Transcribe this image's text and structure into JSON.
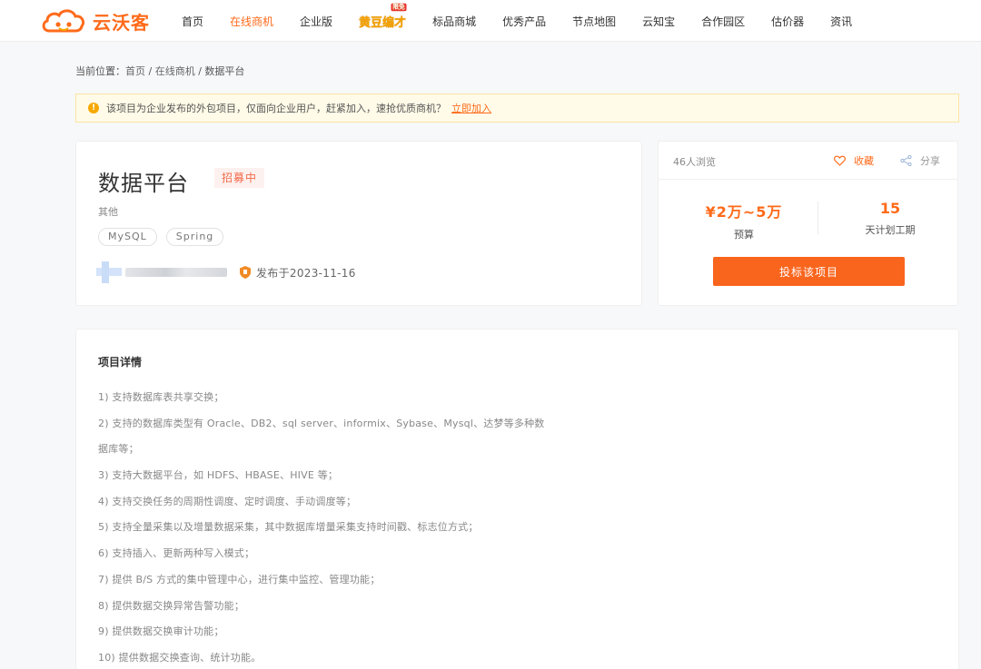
{
  "header": {
    "logo_text": "云沃客",
    "nav": [
      {
        "label": "首页"
      },
      {
        "label": "在线商机"
      },
      {
        "label": "企业版"
      },
      {
        "label": "黄豆编才",
        "badge": "限免"
      },
      {
        "label": "标品商城"
      },
      {
        "label": "优秀产品"
      },
      {
        "label": "节点地图"
      },
      {
        "label": "云知宝"
      },
      {
        "label": "合作园区"
      },
      {
        "label": "估价器"
      },
      {
        "label": "资讯"
      }
    ]
  },
  "breadcrumb": {
    "prefix": "当前位置：",
    "items": [
      "首页",
      "在线商机",
      "数据平台"
    ],
    "separator": " / "
  },
  "notice": {
    "icon": "!",
    "text": "该项目为企业发布的外包项目，仅面向企业用户，赶紧加入，速抢优质商机？",
    "link": "立即加入"
  },
  "project": {
    "title": "数据平台",
    "status": "招募中",
    "category": "其他",
    "tags": [
      "MySQL",
      "Spring"
    ],
    "published": "发布于2023-11-16"
  },
  "sidebar": {
    "views": "46人浏览",
    "favorite": "收藏",
    "share": "分享",
    "budget_value": "¥2万~5万",
    "budget_label": "预算",
    "period_value": "15",
    "period_label": "天计划工期",
    "bid_button": "投标该项目"
  },
  "details": {
    "title": "项目详情",
    "lines": [
      "1) 支持数据库表共享交换；",
      "2) 支持的数据库类型有 Oracle、DB2、sql server、informix、Sybase、Mysql、达梦等多种数",
      "据库等；",
      "3) 支持大数据平台，如 HDFS、HBASE、HIVE 等；",
      "4) 支持交换任务的周期性调度、定时调度、手动调度等；",
      "5) 支持全量采集以及增量数据采集，其中数据库增量采集支持时间戳、标志位方式；",
      "6) 支持插入、更新两种写入模式；",
      "7) 提供 B/S 方式的集中管理中心，进行集中监控、管理功能；",
      "8) 提供数据交换异常告警功能；",
      "9) 提供数据交换审计功能；",
      "10) 提供数据交换查询、统计功能。"
    ]
  },
  "colors": {
    "accent": "#ff6a1a",
    "button": "#f9651d",
    "notice_bg": "#fffbe8",
    "status_bg": "#fdf1ef"
  }
}
